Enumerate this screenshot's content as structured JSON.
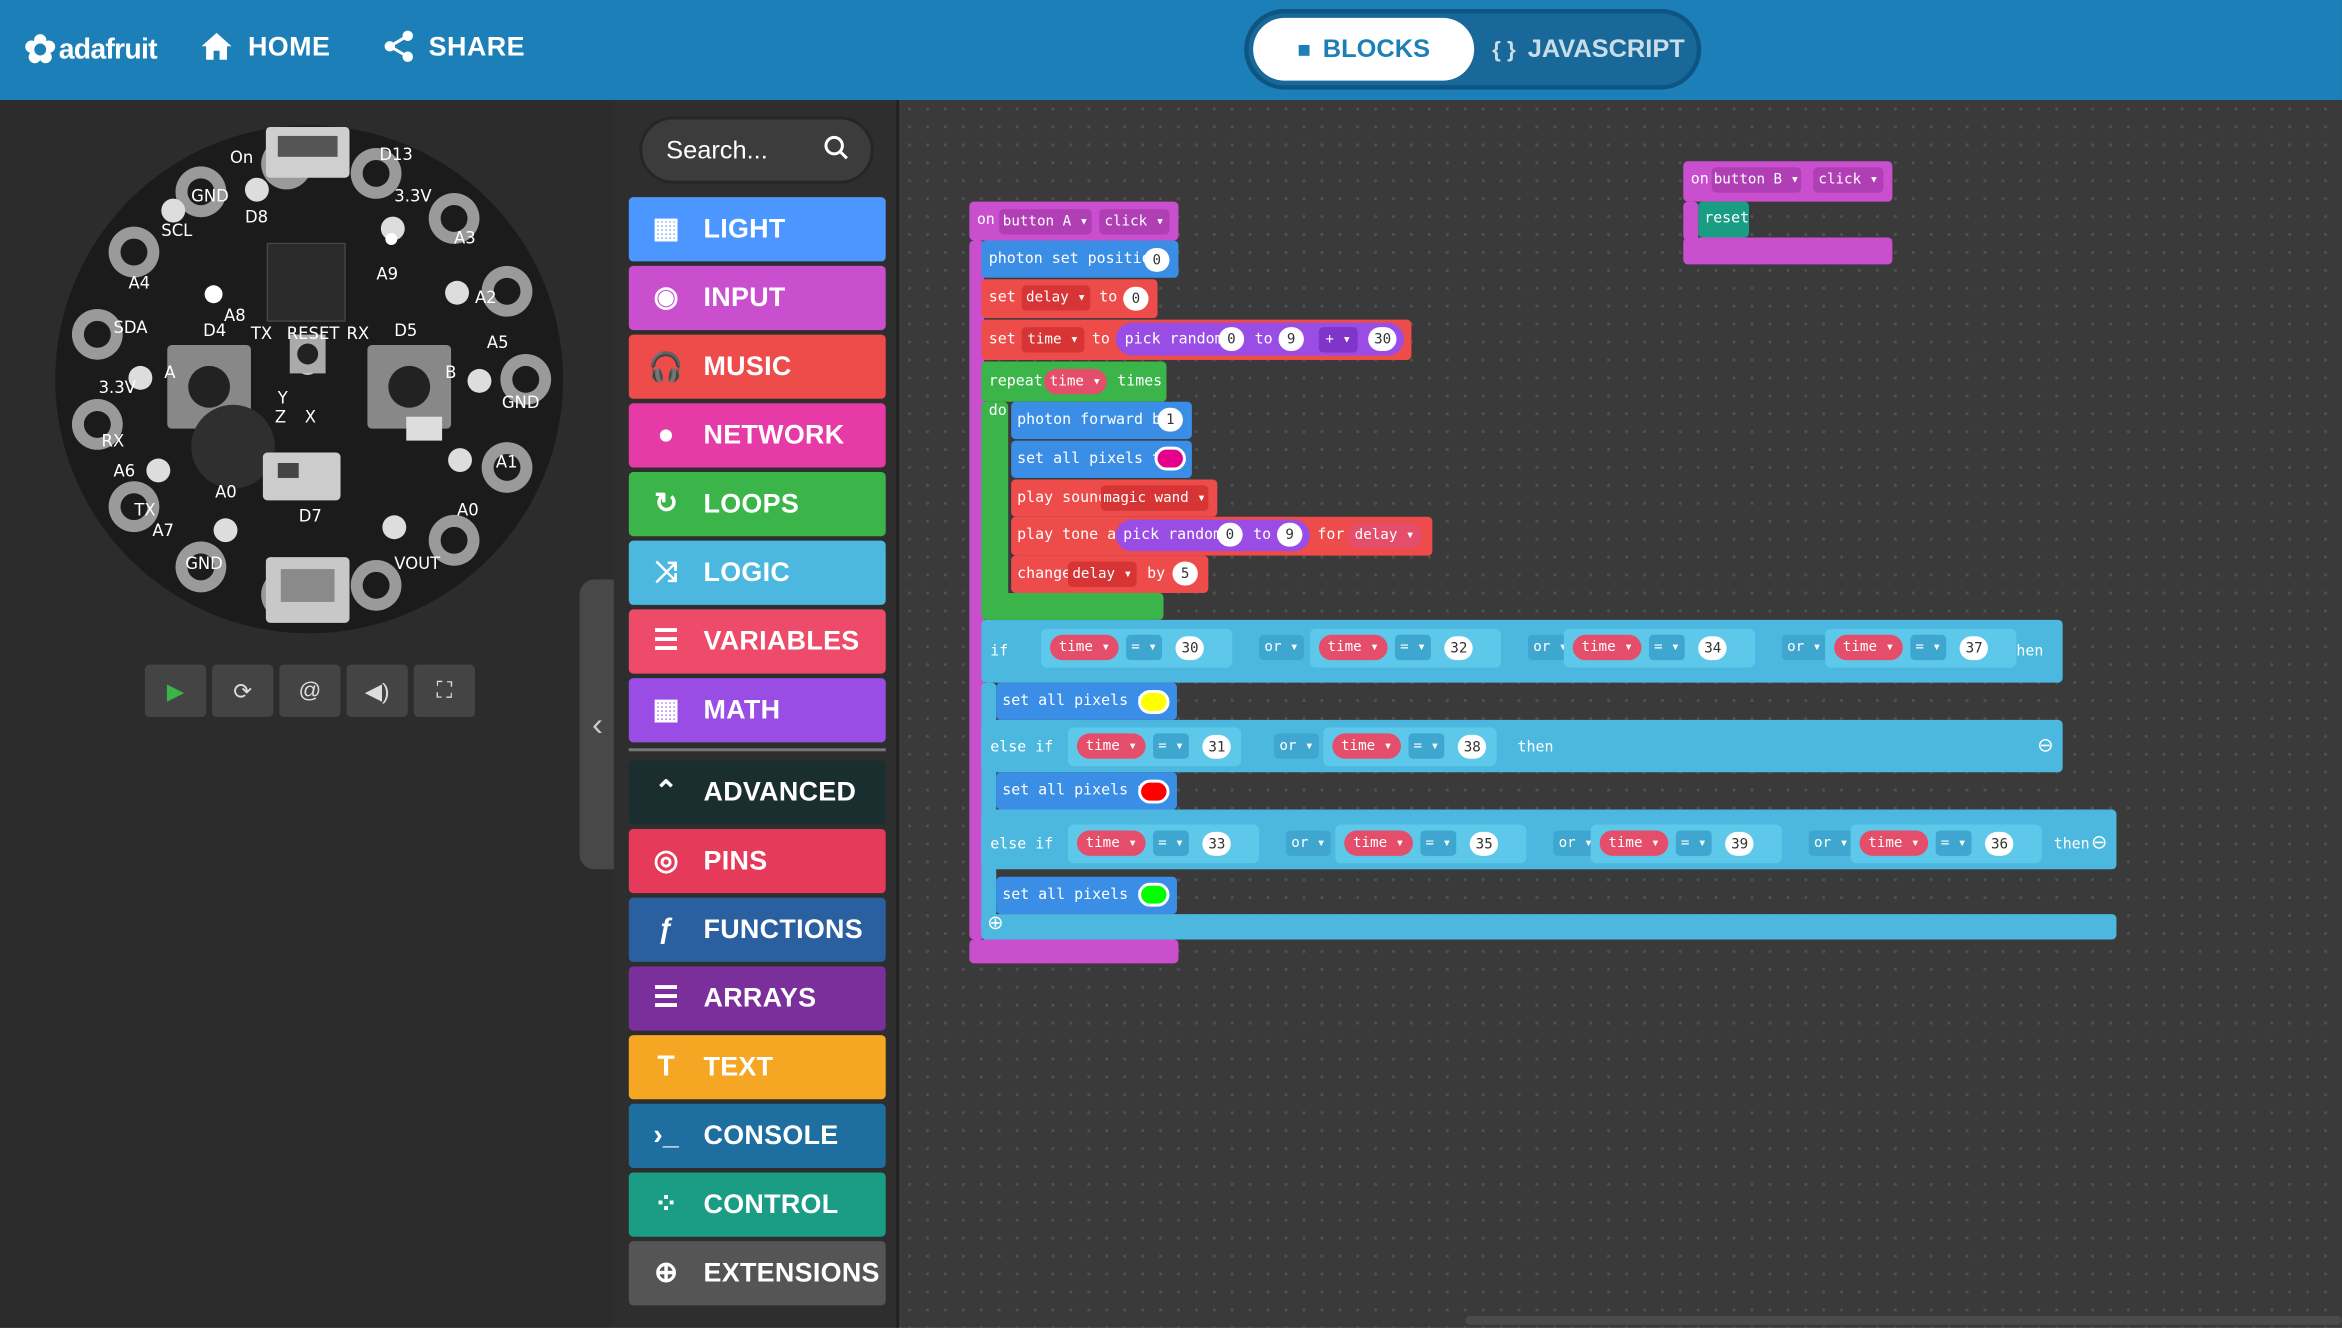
{
  "header": {
    "logo_text": "adafruit",
    "home_label": "HOME",
    "share_label": "SHARE",
    "tab_blocks": "BLOCKS",
    "tab_javascript": "JAVASCRIPT",
    "tab_javascript_icon": "{ }"
  },
  "toolbox": {
    "search_placeholder": "Search...",
    "categories": [
      {
        "label": "LIGHT",
        "color": "#4c97ff",
        "icon": "grid-icon"
      },
      {
        "label": "INPUT",
        "color": "#d400d4",
        "icon": "target-icon"
      },
      {
        "label": "MUSIC",
        "color": "#e63022",
        "icon": "headphones-icon"
      },
      {
        "label": "NETWORK",
        "color": "#e3008c",
        "icon": "chat-icon"
      },
      {
        "label": "LOOPS",
        "color": "#00aa00",
        "icon": "refresh-icon"
      },
      {
        "label": "LOGIC",
        "color": "#00a4a6",
        "icon": "shuffle-icon"
      },
      {
        "label": "VARIABLES",
        "color": "#dc143c",
        "icon": "list-icon"
      },
      {
        "label": "MATH",
        "color": "#9400d3",
        "icon": "calculator-icon"
      },
      {
        "label": "ADVANCED",
        "color": "#00272b",
        "icon": "chevron-up-icon"
      },
      {
        "label": "PINS",
        "color": "#b22222",
        "icon": "pin-icon"
      },
      {
        "label": "FUNCTIONS",
        "color": "#005a9e",
        "icon": "function-icon"
      },
      {
        "label": "ARRAYS",
        "color": "#a94400",
        "icon": "ordered-list-icon"
      },
      {
        "label": "TEXT",
        "color": "#996600",
        "icon": "text-icon"
      },
      {
        "label": "CONSOLE",
        "color": "#015a8c",
        "icon": "terminal-icon"
      },
      {
        "label": "CONTROL",
        "color": "#333333",
        "icon": "dots-circle-icon"
      },
      {
        "label": "EXTENSIONS",
        "color": "#333333",
        "icon": "plus-circle-icon"
      }
    ]
  },
  "board": {
    "labels": [
      "On",
      "D13",
      "GND",
      "3.3V",
      "SCL",
      "A3",
      "A4",
      "A2",
      "SDA",
      "A5",
      "D8",
      "A9",
      "A8",
      "TX",
      "RESET",
      "RX",
      "D4",
      "D5",
      "3.3V",
      "GND",
      "A",
      "B",
      "Y",
      "Z",
      "X",
      "RX",
      "A6",
      "A1",
      "TX",
      "A7",
      "A0",
      "A0",
      "D7",
      "GND",
      "VOUT"
    ]
  },
  "blocks": {
    "on": "on",
    "button_a": "button A",
    "button_b": "button B",
    "click": "click",
    "reset": "reset",
    "photon_set_position": "photon set position",
    "pos_val": "0",
    "set": "set",
    "to": "to",
    "delay": "delay",
    "delay_val": "0",
    "time": "time",
    "pick_random": "pick random",
    "r_from": "0",
    "r_to": "9",
    "plus_op": "+",
    "add_val": "30",
    "repeat": "repeat",
    "times": "times",
    "do": "do",
    "photon_forward_by": "photon forward by",
    "forward_val": "1",
    "set_all_pixels_to": "set all pixels to",
    "play_sound": "play sound",
    "magic_wand": "magic wand",
    "play_tone_at": "play tone at",
    "for": "for",
    "change": "change",
    "by": "by",
    "change_val": "5",
    "if": "if",
    "else_if": "else if",
    "then": "then",
    "or": "or",
    "eq": "=",
    "if_vals": [
      "30",
      "32",
      "34",
      "37"
    ],
    "elif1_vals": [
      "31",
      "38"
    ],
    "elif2_vals": [
      "33",
      "35",
      "39",
      "36"
    ],
    "pixel_colors": [
      "#e5008c",
      "#ffff00",
      "#ff0000",
      "#00ff00"
    ]
  }
}
